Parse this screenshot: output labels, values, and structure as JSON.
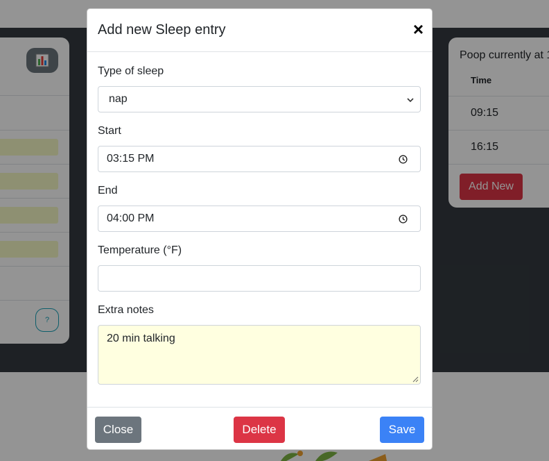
{
  "background": {
    "right_card": {
      "title": "Poop currently at 1",
      "column_header": "Time",
      "rows": [
        "09:15",
        "16:15"
      ],
      "add_button": "Add New"
    },
    "left_card": {
      "help_button": "?"
    }
  },
  "modal": {
    "title": "Add new Sleep entry",
    "close_symbol": "×",
    "fields": {
      "type_label": "Type of sleep",
      "type_value": "nap",
      "start_label": "Start",
      "start_value": "03:15 PM",
      "end_label": "End",
      "end_value": "04:00 PM",
      "temperature_label": "Temperature (°F)",
      "temperature_value": "",
      "notes_label": "Extra notes",
      "notes_value": "20 min talking"
    },
    "footer": {
      "close_label": "Close",
      "delete_label": "Delete",
      "save_label": "Save"
    }
  },
  "colors": {
    "primary": "#3b82f6",
    "danger": "#dc3545",
    "secondary": "#6c757d",
    "notes_background": "#ffffe0"
  }
}
